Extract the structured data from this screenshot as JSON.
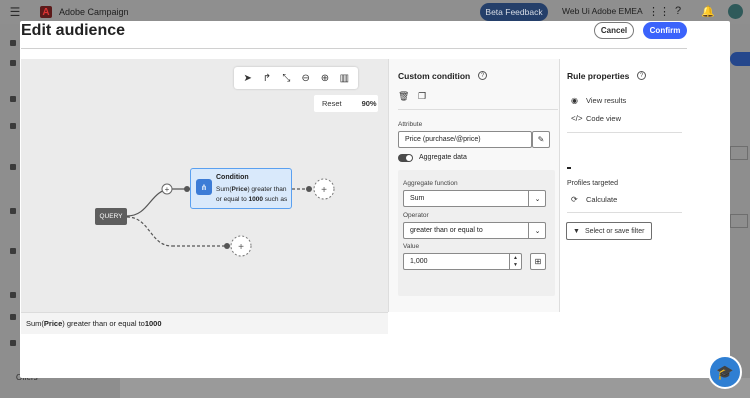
{
  "topbar": {
    "app_title": "Adobe Campaign",
    "beta_label": "Beta Feedback",
    "org": "Web Ui Adobe EMEA"
  },
  "background": {
    "offers_label": "Offers"
  },
  "modal": {
    "title": "Edit audience",
    "cancel_label": "Cancel",
    "confirm_label": "Confirm"
  },
  "canvas": {
    "reset_label": "Reset",
    "zoom_value": "90%",
    "query_label": "QUERY",
    "condition": {
      "title": "Condition",
      "desc_1": "Sum(",
      "desc_2": "Price",
      "desc_3": ") greater than or equal to ",
      "desc_4": "1000",
      "desc_5": " such as"
    },
    "footer": {
      "p1": "Sum(",
      "p2": "Price",
      "p3": ") greater than or equal to ",
      "p4": "1000"
    }
  },
  "custom_condition": {
    "title": "Custom condition",
    "attribute_label": "Attribute",
    "attribute_value": "Price (purchase/@price)",
    "aggregate_toggle_label": "Aggregate data",
    "aggregate_function_label": "Aggregate function",
    "aggregate_function_value": "Sum",
    "operator_label": "Operator",
    "operator_value": "greater than or equal to",
    "value_label": "Value",
    "value_value": "1,000"
  },
  "rule_properties": {
    "title": "Rule properties",
    "view_results_label": "View results",
    "code_view_label": "Code view",
    "profiles_targeted_label": "Profiles targeted",
    "calculate_label": "Calculate",
    "filter_button_label": "Select or save filter"
  },
  "colors": {
    "accent": "#3b63fb",
    "condition_fill": "#d9e9fb",
    "condition_border": "#5aa0f0"
  }
}
